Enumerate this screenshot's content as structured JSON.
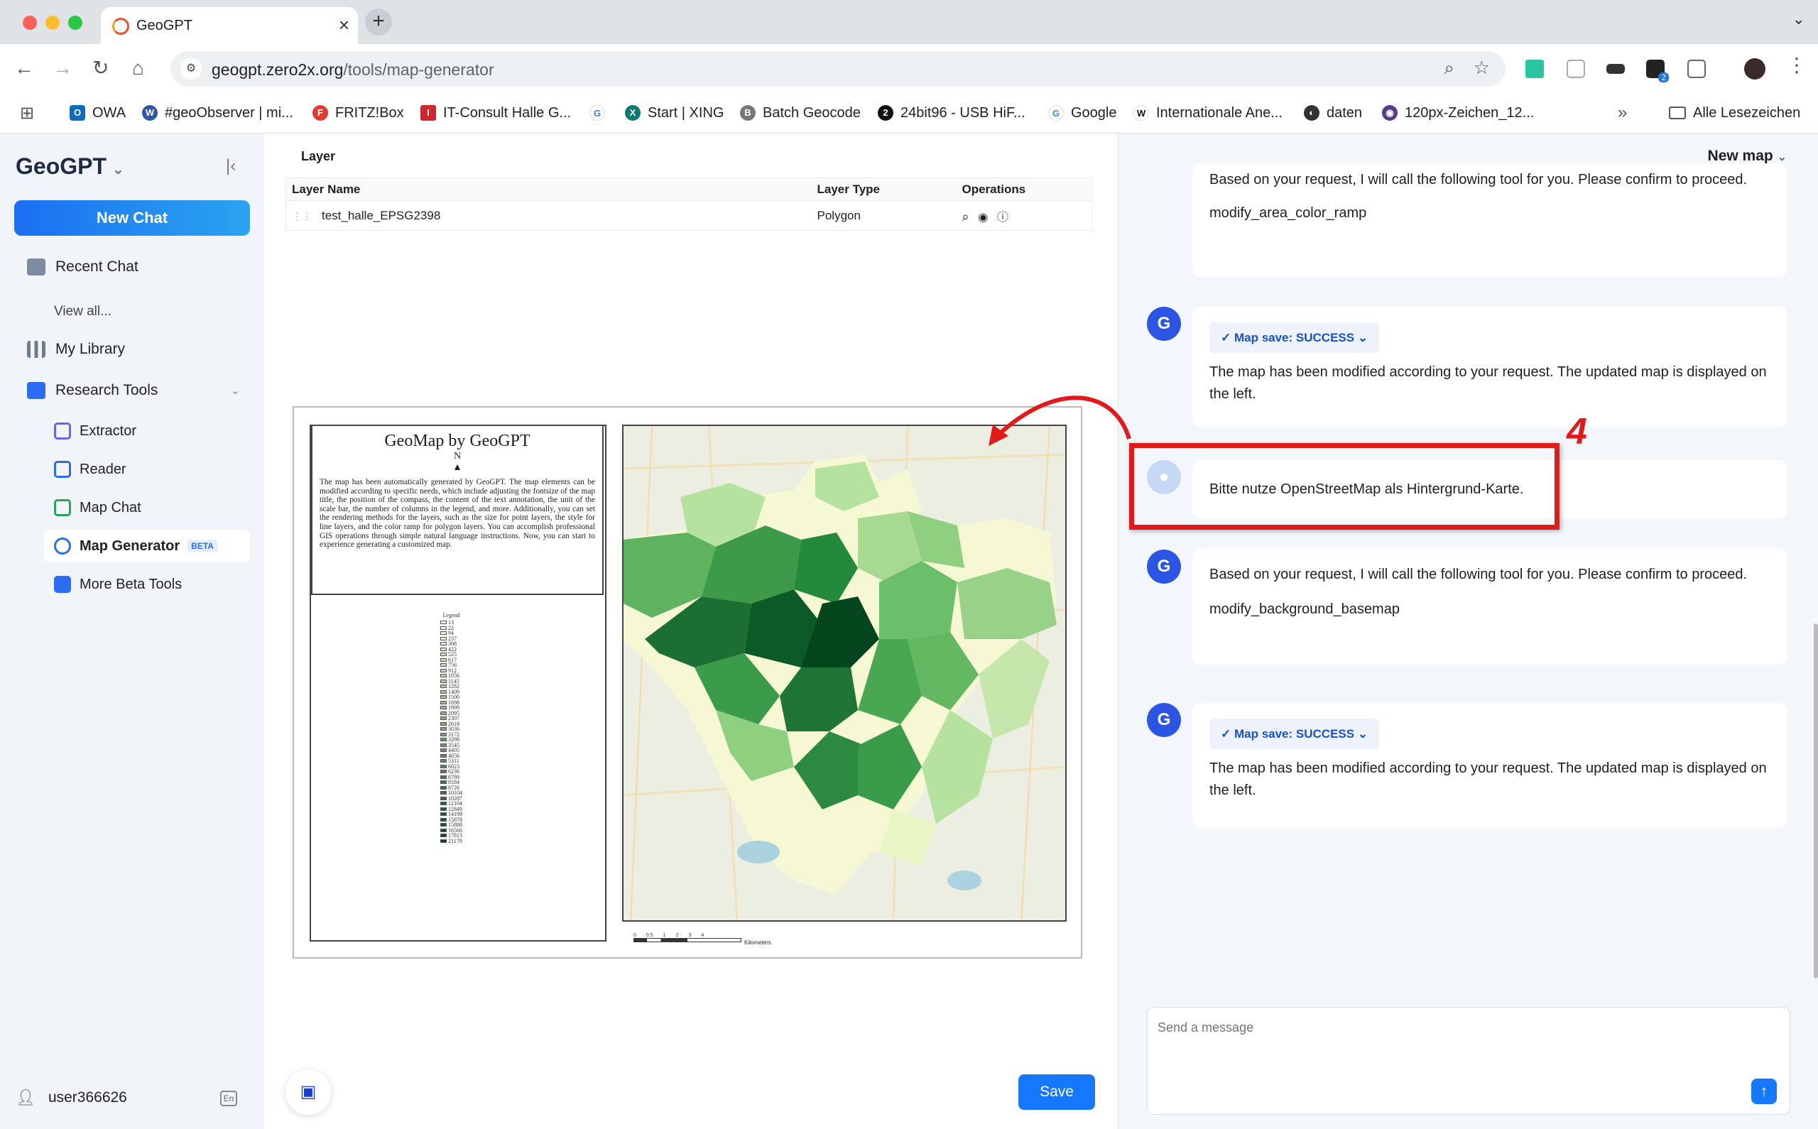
{
  "browser": {
    "tab_title": "GeoGPT",
    "url_host": "geogpt.zero2x.org",
    "url_path": "/tools/map-generator",
    "bookmarks": [
      "OWA",
      "#geoObserver | mi...",
      "FRITZ!Box",
      "IT-Consult Halle G...",
      "Start | XING",
      "Batch Geocode",
      "24bit96 - USB HiF...",
      "Google",
      "Internationale Ane...",
      "daten",
      "120px-Zeichen_12..."
    ],
    "all_bookmarks": "Alle Lesezeichen",
    "extension_badge": "2"
  },
  "sidebar": {
    "logo": "GeoGPT",
    "new_chat": "New Chat",
    "recent_chat": "Recent Chat",
    "view_all": "View all...",
    "my_library": "My Library",
    "research_tools": "Research Tools",
    "tools": [
      {
        "label": "Extractor"
      },
      {
        "label": "Reader"
      },
      {
        "label": "Map Chat"
      },
      {
        "label": "Map Generator",
        "badge": "BETA"
      },
      {
        "label": "More Beta Tools"
      }
    ],
    "username": "user366626",
    "lang": "En"
  },
  "layers": {
    "section_title": "Layer",
    "headers": [
      "Layer Name",
      "Layer Type",
      "Operations"
    ],
    "rows": [
      {
        "name": "test_halle_EPSG2398",
        "type": "Polygon"
      }
    ]
  },
  "map": {
    "title": "GeoMap by GeoGPT",
    "north": "N",
    "description": "The map has been automatically generated by GeoGPT. The map elements can be modified according to specific needs, which include adjusting the fontsize of the map title, the position of the compass, the content of the text annotation, the unit of the scale bar, the number of columns in the legend, and more. Additionally, you can set the rendering methods for the layers, such as the size for point layers, the style for line layers, and the color ramp for polygon layers. You can accomplish professional GIS operations through simple natural language instructions. Now, you can start to experience generating a customized map.",
    "legend_title": "Legend",
    "legend_values": [
      "13",
      "22",
      "94",
      "237",
      "308",
      "422",
      "525",
      "617",
      "756",
      "912",
      "1056",
      "1145",
      "1282",
      "1409",
      "1500",
      "1698",
      "1999",
      "2095",
      "2307",
      "2618",
      "3036",
      "3172",
      "3298",
      "3545",
      "4405",
      "4656",
      "5311",
      "6023",
      "6236",
      "6789",
      "8184",
      "8726",
      "10104",
      "10287",
      "12104",
      "12849",
      "14198",
      "15878",
      "15888",
      "16566",
      "17813",
      "21179"
    ],
    "scale_unit": "Kilometers",
    "scale_ticks": [
      "0",
      "0.5",
      "1",
      "2",
      "3",
      "4"
    ]
  },
  "save_label": "Save",
  "chat": {
    "header": "New map",
    "messages": [
      {
        "role": "bot",
        "text": "Based on your request, I will call the following tool for you. Please confirm to proceed.",
        "tool": "modify_area_color_ramp"
      },
      {
        "role": "bot",
        "status": "Map save: SUCCESS",
        "text": "The map has been modified according to your request. The updated map is displayed on the left."
      },
      {
        "role": "user",
        "text": "Bitte nutze OpenStreetMap als Hintergrund-Karte."
      },
      {
        "role": "bot",
        "text": "Based on your request, I will call the following tool for you. Please confirm to proceed.",
        "tool": "modify_background_basemap"
      },
      {
        "role": "bot",
        "status": "Map save: SUCCESS",
        "text": "The map has been modified according to your request. The updated map is displayed on the left."
      }
    ],
    "input_placeholder": "Send a message"
  },
  "annotation": {
    "step_number": "4",
    "color": "#e21a1a"
  }
}
